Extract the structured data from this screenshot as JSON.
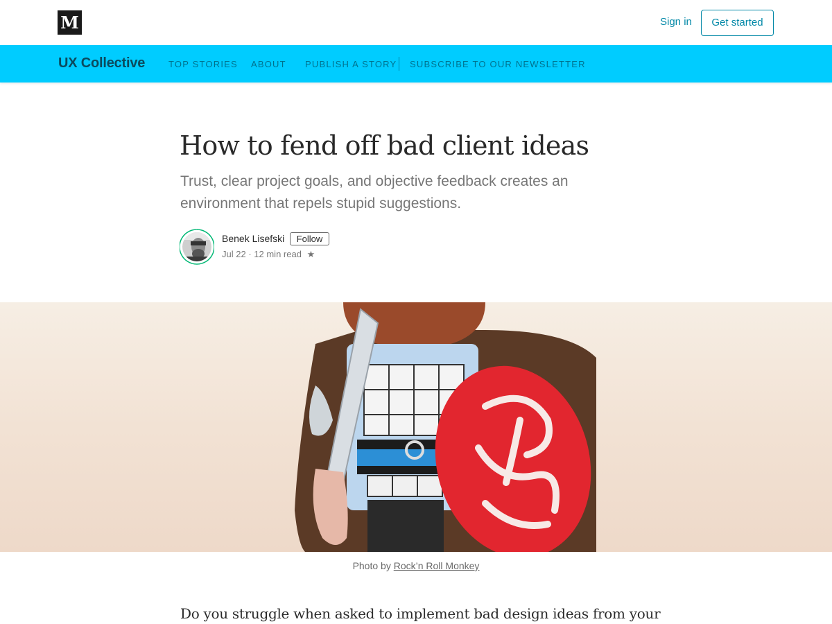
{
  "header": {
    "logo_text": "M",
    "signin_label": "Sign in",
    "get_started_label": "Get started"
  },
  "publication": {
    "name": "UX Collective",
    "nav": [
      "TOP STORIES",
      "ABOUT",
      "PUBLISH A STORY",
      "SUBSCRIBE TO OUR NEWSLETTER"
    ]
  },
  "article": {
    "title": "How to fend off bad client ideas",
    "subtitle": "Trust, clear project goals, and objective feedback creates an environment that repels stupid suggestions.",
    "author": "Benek Lisefski",
    "follow_label": "Follow",
    "date": "Jul 22",
    "read_time": "12 min read",
    "star": "★",
    "caption_prefix": "Photo by ",
    "caption_credit": "Rock’n Roll Monkey",
    "first_line": "Do you struggle when asked to implement bad design ideas from your"
  },
  "colors": {
    "accent": "#00ccff",
    "brand_link": "#0288a7",
    "avatar_ring": "#02b875"
  },
  "icons": {
    "logo": "medium-logo",
    "avatar": "author-avatar",
    "star": "bookmark-star-icon"
  }
}
